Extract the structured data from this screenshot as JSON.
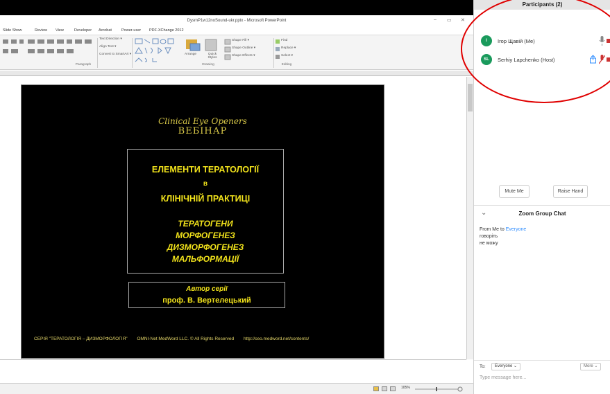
{
  "ppt": {
    "title": "DysmP1w12noSound-ukr.pptx - Microsoft PowerPoint",
    "window_minimize": "–",
    "window_restore": "▭",
    "window_close": "✕",
    "tabs": [
      "Slide Show",
      "Review",
      "View",
      "Developer",
      "Acrobat",
      "Power-user",
      "PDF-XChange 2012"
    ],
    "ribbon": {
      "text_direction": "Text Direction ▾",
      "align_text": "Align Text ▾",
      "convert_smartart": "Convert to SmartArt ▾",
      "arrange": "Arrange",
      "quick_styles": "Quick Styles",
      "shape_fill": "Shape Fill ▾",
      "shape_outline": "Shape Outline ▾",
      "shape_effects": "Shape Effects ▾",
      "find": "Find",
      "replace": "Replace ▾",
      "select": "Select ▾",
      "group_paragraph": "Paragraph",
      "group_drawing": "Drawing",
      "group_editing": "Editing"
    },
    "slide": {
      "brand1": "Clinical Eye Openers",
      "brand2": "ВЕБІНАР",
      "title1": "ЕЛЕМЕНТИ ТЕРАТОЛОГІЇ",
      "title2": "в",
      "title3": "КЛІНІЧНІЙ ПРАКТИЦІ",
      "item1": "ТЕРАТОГЕНИ",
      "item2": "МОРФОГЕНЕЗ",
      "item3": "ДИЗМОРФОГЕНЕЗ",
      "item4": "МАЛЬФОРМАЦІЇ",
      "author_label": "Автор серії",
      "author_name": "проф. В. Вертелецький",
      "footer1": "СЕРІЯ \"ТЕРАТОЛОГІЯ – ДИЗМОРФОЛОГІЯ\"",
      "footer2": "OMNI-Net MedWord LLC. © All Rights Reserved",
      "footer3": "http://ceo.medword.net/contents/"
    },
    "statusbar": {
      "zoom": "105%"
    }
  },
  "zoom": {
    "participants_title": "Participants (2)",
    "participants": [
      {
        "initials": "І",
        "name": "Ігор Щавій (Me)",
        "color": "#1a9a5c"
      },
      {
        "initials": "SL",
        "name": "Serhiy Lapchenko (Host)",
        "color": "#1a9a5c"
      }
    ],
    "mute_me": "Mute Me",
    "raise_hand": "Raise Hand",
    "chat_title": "Zoom Group Chat",
    "chat": {
      "from": "From Me to ",
      "to_name": "Everyone",
      "line1": "говоріть",
      "line2": "не можу"
    },
    "to_label": "To:",
    "to_value": "Everyone ⌄",
    "more": "More ⌄",
    "input_placeholder": "Type message here..."
  },
  "colors": {
    "accent_yellow": "#f2e31b",
    "zoom_blue": "#2d8cff",
    "annotation_red": "#e00000"
  },
  "icons": [
    "chevron-down-icon",
    "microphone-icon",
    "video-off-icon",
    "share-icon",
    "muted-microphone-icon"
  ]
}
